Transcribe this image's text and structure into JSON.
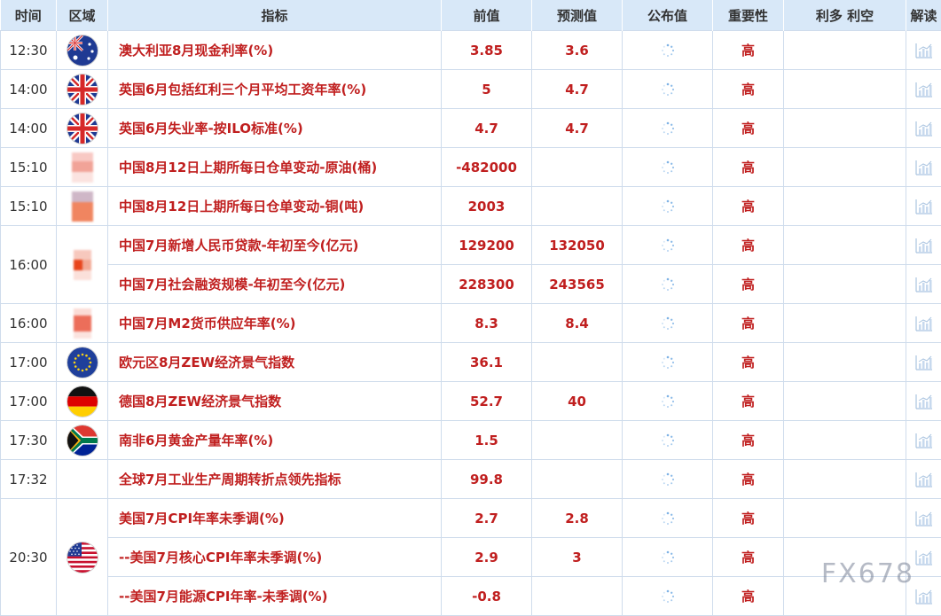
{
  "header": {
    "time": "时间",
    "region": "区域",
    "indicator": "指标",
    "prev": "前值",
    "forecast": "预测值",
    "actual": "公布值",
    "importance": "重要性",
    "impact": "利多 利空",
    "analysis": "解读"
  },
  "rows": [
    {
      "time": "12:30",
      "name": "澳大利亚8月现金利率(%)",
      "prev": "3.85",
      "forecast": "3.6",
      "importance": "高",
      "flag": "australia-flag"
    },
    {
      "time": "14:00",
      "name": "英国6月包括红利三个月平均工资年率(%)",
      "prev": "5",
      "forecast": "4.7",
      "importance": "高",
      "flag": "uk-flag"
    },
    {
      "time": "14:00",
      "name": "英国6月失业率-按ILO标准(%)",
      "prev": "4.7",
      "forecast": "4.7",
      "importance": "高",
      "flag": "uk-flag"
    },
    {
      "time": "15:10",
      "name": "中国8月12日上期所每日仓单变动-原油(桶)",
      "prev": "-482000",
      "forecast": "",
      "importance": "高",
      "flag": "china-flag"
    },
    {
      "time": "15:10",
      "name": "中国8月12日上期所每日仓单变动-铜(吨)",
      "prev": "2003",
      "forecast": "",
      "importance": "高",
      "flag": "china-flag"
    },
    {
      "time": "16:00",
      "name": "中国7月新增人民币贷款-年初至今(亿元)",
      "prev": "129200",
      "forecast": "132050",
      "importance": "高",
      "flag": "china-flag"
    },
    {
      "time": "",
      "name": "中国7月社会融资规模-年初至今(亿元)",
      "prev": "228300",
      "forecast": "243565",
      "importance": "高",
      "flag": ""
    },
    {
      "time": "16:00",
      "name": "中国7月M2货币供应年率(%)",
      "prev": "8.3",
      "forecast": "8.4",
      "importance": "高",
      "flag": "china-flag"
    },
    {
      "time": "17:00",
      "name": "欧元区8月ZEW经济景气指数",
      "prev": "36.1",
      "forecast": "",
      "importance": "高",
      "flag": "eu-flag"
    },
    {
      "time": "17:00",
      "name": "德国8月ZEW经济景气指数",
      "prev": "52.7",
      "forecast": "40",
      "importance": "高",
      "flag": "germany-flag"
    },
    {
      "time": "17:30",
      "name": "南非6月黄金产量年率(%)",
      "prev": "1.5",
      "forecast": "",
      "importance": "高",
      "flag": "south-africa-flag"
    },
    {
      "time": "17:32",
      "name": "全球7月工业生产周期转折点领先指标",
      "prev": "99.8",
      "forecast": "",
      "importance": "高",
      "flag": ""
    },
    {
      "time": "20:30",
      "name": "美国7月CPI年率未季调(%)",
      "prev": "2.7",
      "forecast": "2.8",
      "importance": "高",
      "flag": "usa-flag"
    },
    {
      "time": "",
      "name": "--美国7月核心CPI年率未季调(%)",
      "prev": "2.9",
      "forecast": "3",
      "importance": "高",
      "flag": ""
    },
    {
      "time": "",
      "name": "--美国7月能源CPI年率-未季调(%)",
      "prev": "-0.8",
      "forecast": "",
      "importance": "高",
      "flag": ""
    }
  ],
  "watermark": "FX678",
  "colors": {
    "header_bg": "#d8e8f8",
    "value_red": "#c01f1f",
    "border": "#cfdcec"
  }
}
